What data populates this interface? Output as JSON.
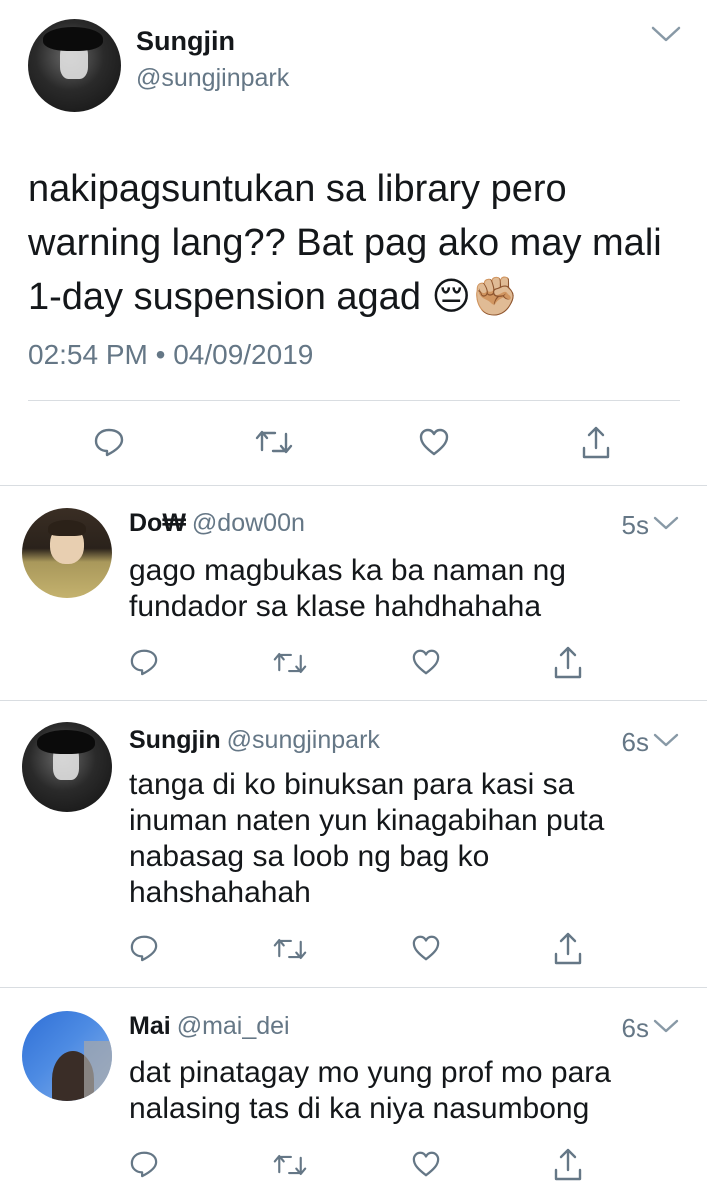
{
  "main_tweet": {
    "name": "Sungjin",
    "handle": "@sungjinpark",
    "text_lines": [
      "nakipagsuntukan sa library pero",
      "warning lang?? Bat pag ako may mali",
      "1-day suspension agad 😔✊🏼"
    ],
    "timestamp": "02:54 PM • 04/09/2019"
  },
  "replies": [
    {
      "name": "Do₩",
      "handle": "@dow00n",
      "time": "5s",
      "text_lines": [
        "gago magbukas ka ba naman ng",
        "fundador sa klase hahdhahaha"
      ]
    },
    {
      "name": "Sungjin",
      "handle": "@sungjinpark",
      "time": "6s",
      "text_lines": [
        "tanga di ko binuksan para kasi sa",
        "inuman naten yun kinagabihan puta",
        "nabasag sa loob ng bag ko",
        "hahshahahah"
      ]
    },
    {
      "name": "Mai",
      "handle": "@mai_dei",
      "time": "6s",
      "text_lines": [
        "dat pinatagay mo yung prof mo para",
        "nalasing tas di ka niya nasumbong"
      ]
    }
  ],
  "colors": {
    "text": "#14171a",
    "muted": "#657786",
    "divider": "#d9dde1"
  },
  "icons": [
    "chevron-down-icon",
    "reply-icon",
    "retweet-icon",
    "like-icon",
    "share-icon"
  ]
}
